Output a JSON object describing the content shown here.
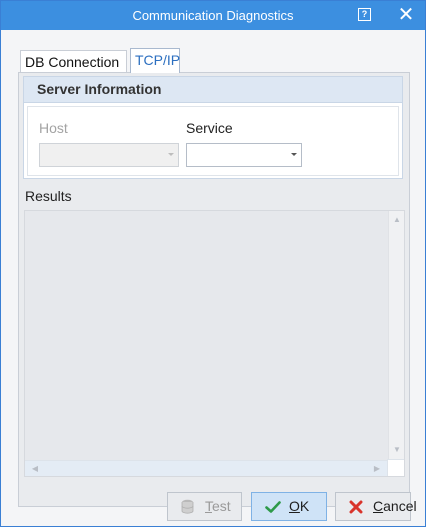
{
  "window": {
    "title": "Communication Diagnostics",
    "help_glyph": "?",
    "close_glyph": "✕"
  },
  "tabs": [
    {
      "label": "DB Connection",
      "active": false
    },
    {
      "label": "TCP/IP",
      "active": true
    }
  ],
  "server_info": {
    "header": "Server Information",
    "host_label": "Host",
    "host_value": "",
    "service_label": "Service",
    "service_value": ""
  },
  "results": {
    "label": "Results",
    "content": ""
  },
  "buttons": {
    "test": {
      "prefix": "",
      "accel": "T",
      "rest": "est",
      "enabled": false
    },
    "ok": {
      "prefix": "",
      "accel": "O",
      "rest": "K",
      "enabled": true
    },
    "cancel": {
      "prefix": "",
      "accel": "C",
      "rest": "ancel",
      "enabled": true
    }
  },
  "colors": {
    "titlebar": "#3c8fe0",
    "ok_icon": "#2e9a4a",
    "cancel_icon": "#d9342b"
  },
  "icons": {
    "test": "database-icon",
    "ok": "checkmark-icon",
    "cancel": "x-icon"
  }
}
